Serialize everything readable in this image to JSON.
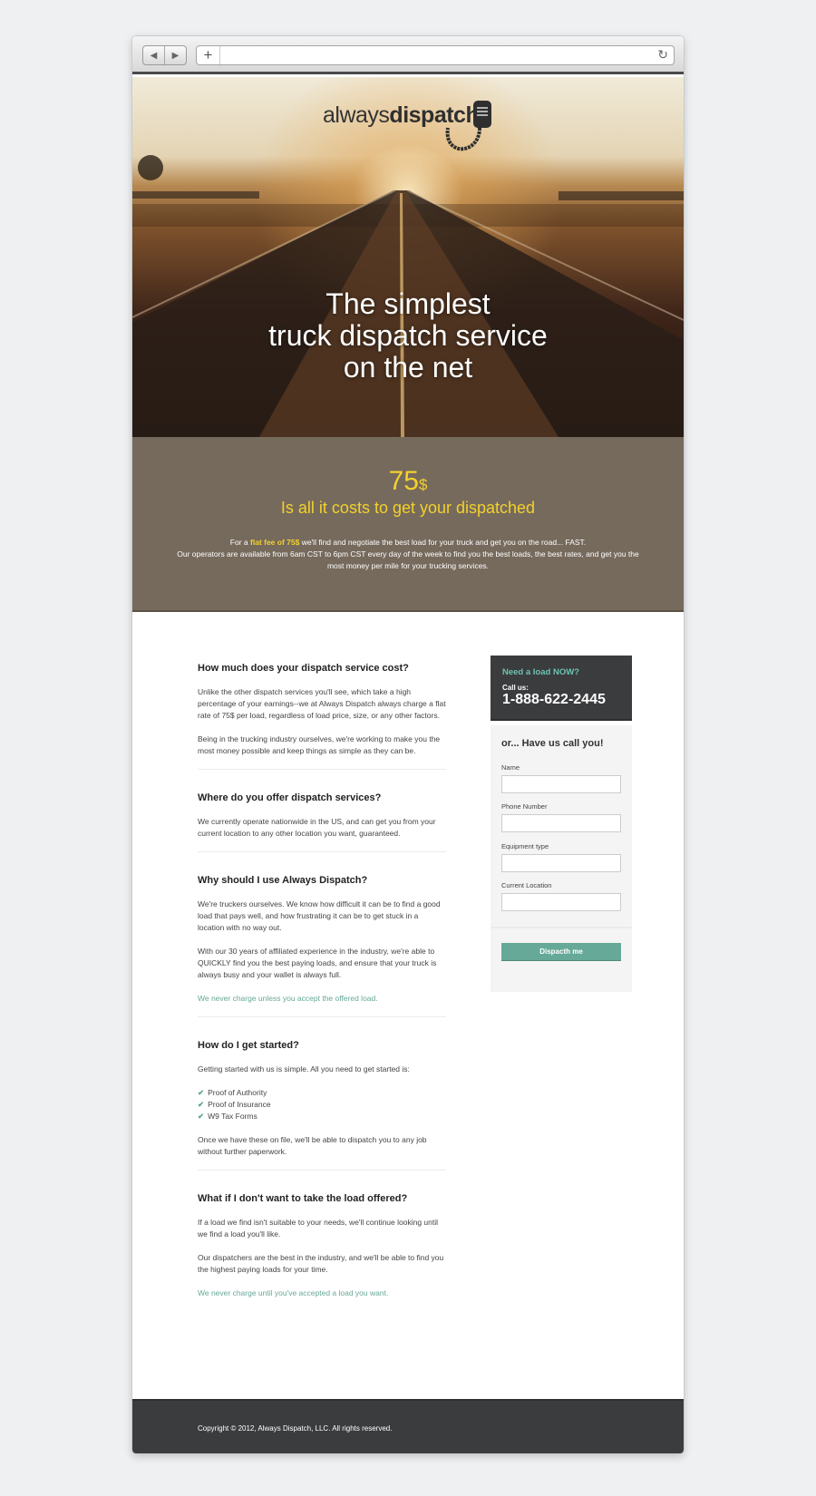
{
  "browser": {
    "back_icon": "◀",
    "forward_icon": "▶",
    "new_tab_icon": "+",
    "reload_icon": "↻",
    "url": ""
  },
  "hero": {
    "logo_light": "always",
    "logo_bold": "dispatch",
    "title_line1": "The simplest",
    "title_line2": "truck dispatch service",
    "title_line3": "on the net"
  },
  "pricing": {
    "price": "75",
    "currency": "$",
    "tagline": "Is all it costs to get your dispatched",
    "desc_prefix": "For a ",
    "desc_highlight": "flat fee of 75$",
    "desc_line1": " we'll find and negotiate the best load for your truck and get you on the road... FAST.",
    "desc_line2": "Our operators are available from 6am CST to 6pm CST every day of the week to find you the best loads, the best rates, and get you the most money per mile for your trucking services."
  },
  "faq": [
    {
      "question": "How much does your dispatch service cost?",
      "p1": "Unlike the other dispatch services you'll see, which take a high percentage of your earnings--we at Always Dispatch always charge a flat rate of 75$ per load, regardless of load price, size, or any other factors.",
      "p2": "Being in the trucking industry ourselves, we're working to make you the most money possible and keep things as simple as they can be."
    },
    {
      "question": "Where do you offer dispatch services?",
      "p1": "We currently operate nationwide in the US, and can get you from your current location to any other location you want, guaranteed."
    },
    {
      "question": "Why should I use Always Dispatch?",
      "p1": "We're truckers ourselves. We know how difficult it can be to find a good load that pays well, and how frustrating it can be to get stuck in a location with no way out.",
      "p2": "With our 30 years of affiliated experience in the industry, we're able to QUICKLY find you the best paying loads, and ensure that your truck is always busy and your wallet is always full.",
      "note": "We never charge unless you accept the offered load."
    },
    {
      "question": "How do I get started?",
      "p1": "Getting started with us is simple. All you need to get started is:",
      "checklist": [
        "Proof of Authority",
        "Proof of Insurance",
        "W9 Tax Forms"
      ],
      "p2": "Once we have these on file, we'll be able to dispatch you to any job without further paperwork."
    },
    {
      "question": "What if I don't want to take the load offered?",
      "p1": "If a load we find isn't suitable to your needs, we'll continue looking until we find a load you'll like.",
      "p2": "Our dispatchers are the best in the industry, and we'll be able to find you the highest paying loads for your time.",
      "note": "We never charge until you've accepted a load you want."
    }
  ],
  "sidebar": {
    "need_load": "Need a load NOW?",
    "call_us": "Call us:",
    "phone": "1-888-622-2445",
    "form_title": "or... Have us call you!",
    "fields": [
      {
        "label": "Name",
        "value": ""
      },
      {
        "label": "Phone Number",
        "value": ""
      },
      {
        "label": "Equipment type",
        "value": ""
      },
      {
        "label": "Current Location",
        "value": ""
      }
    ],
    "submit_label": "Dispacth me"
  },
  "footer": {
    "copyright": "Copyright © 2012, Always Dispatch, LLC. All rights reserved."
  },
  "colors": {
    "accent_yellow": "#f2d12c",
    "accent_green": "#66a998",
    "dark_panel": "#3b3c3e",
    "price_band": "#766a5d"
  }
}
